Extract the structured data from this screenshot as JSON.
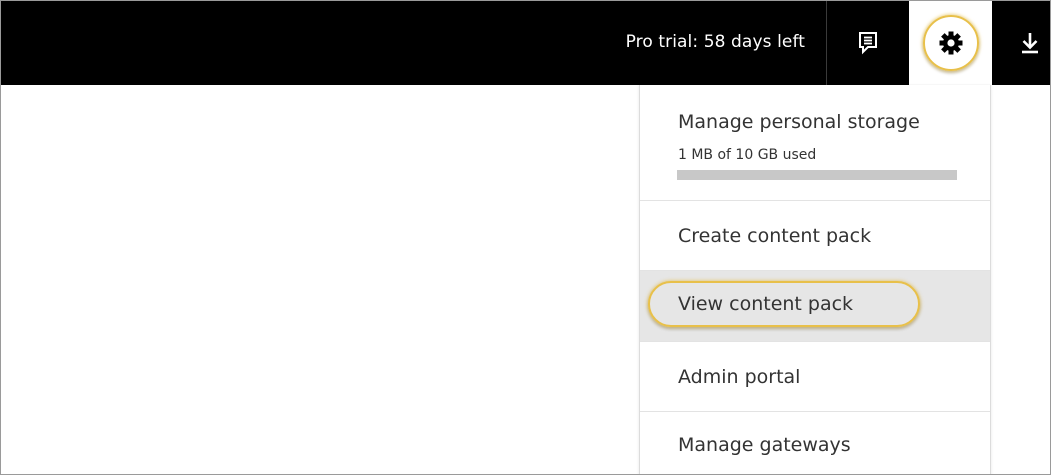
{
  "header": {
    "trial_text": "Pro trial: 58 days left",
    "feedback_icon": "feedback-icon",
    "settings_icon": "gear-icon",
    "download_icon": "download-icon"
  },
  "settings_menu": {
    "storage": {
      "title": "Manage personal storage",
      "used_text": "1 MB of 10 GB used",
      "used_fraction": 0.0001
    },
    "items": [
      {
        "label": "Create content pack"
      },
      {
        "label": "View content pack",
        "highlighted": true
      },
      {
        "label": "Admin portal"
      },
      {
        "label": "Manage gateways"
      }
    ]
  },
  "colors": {
    "topbar": "#000000",
    "highlight_ring": "#e8c04a",
    "hover_row": "#e6e6e6",
    "text": "#333333"
  }
}
